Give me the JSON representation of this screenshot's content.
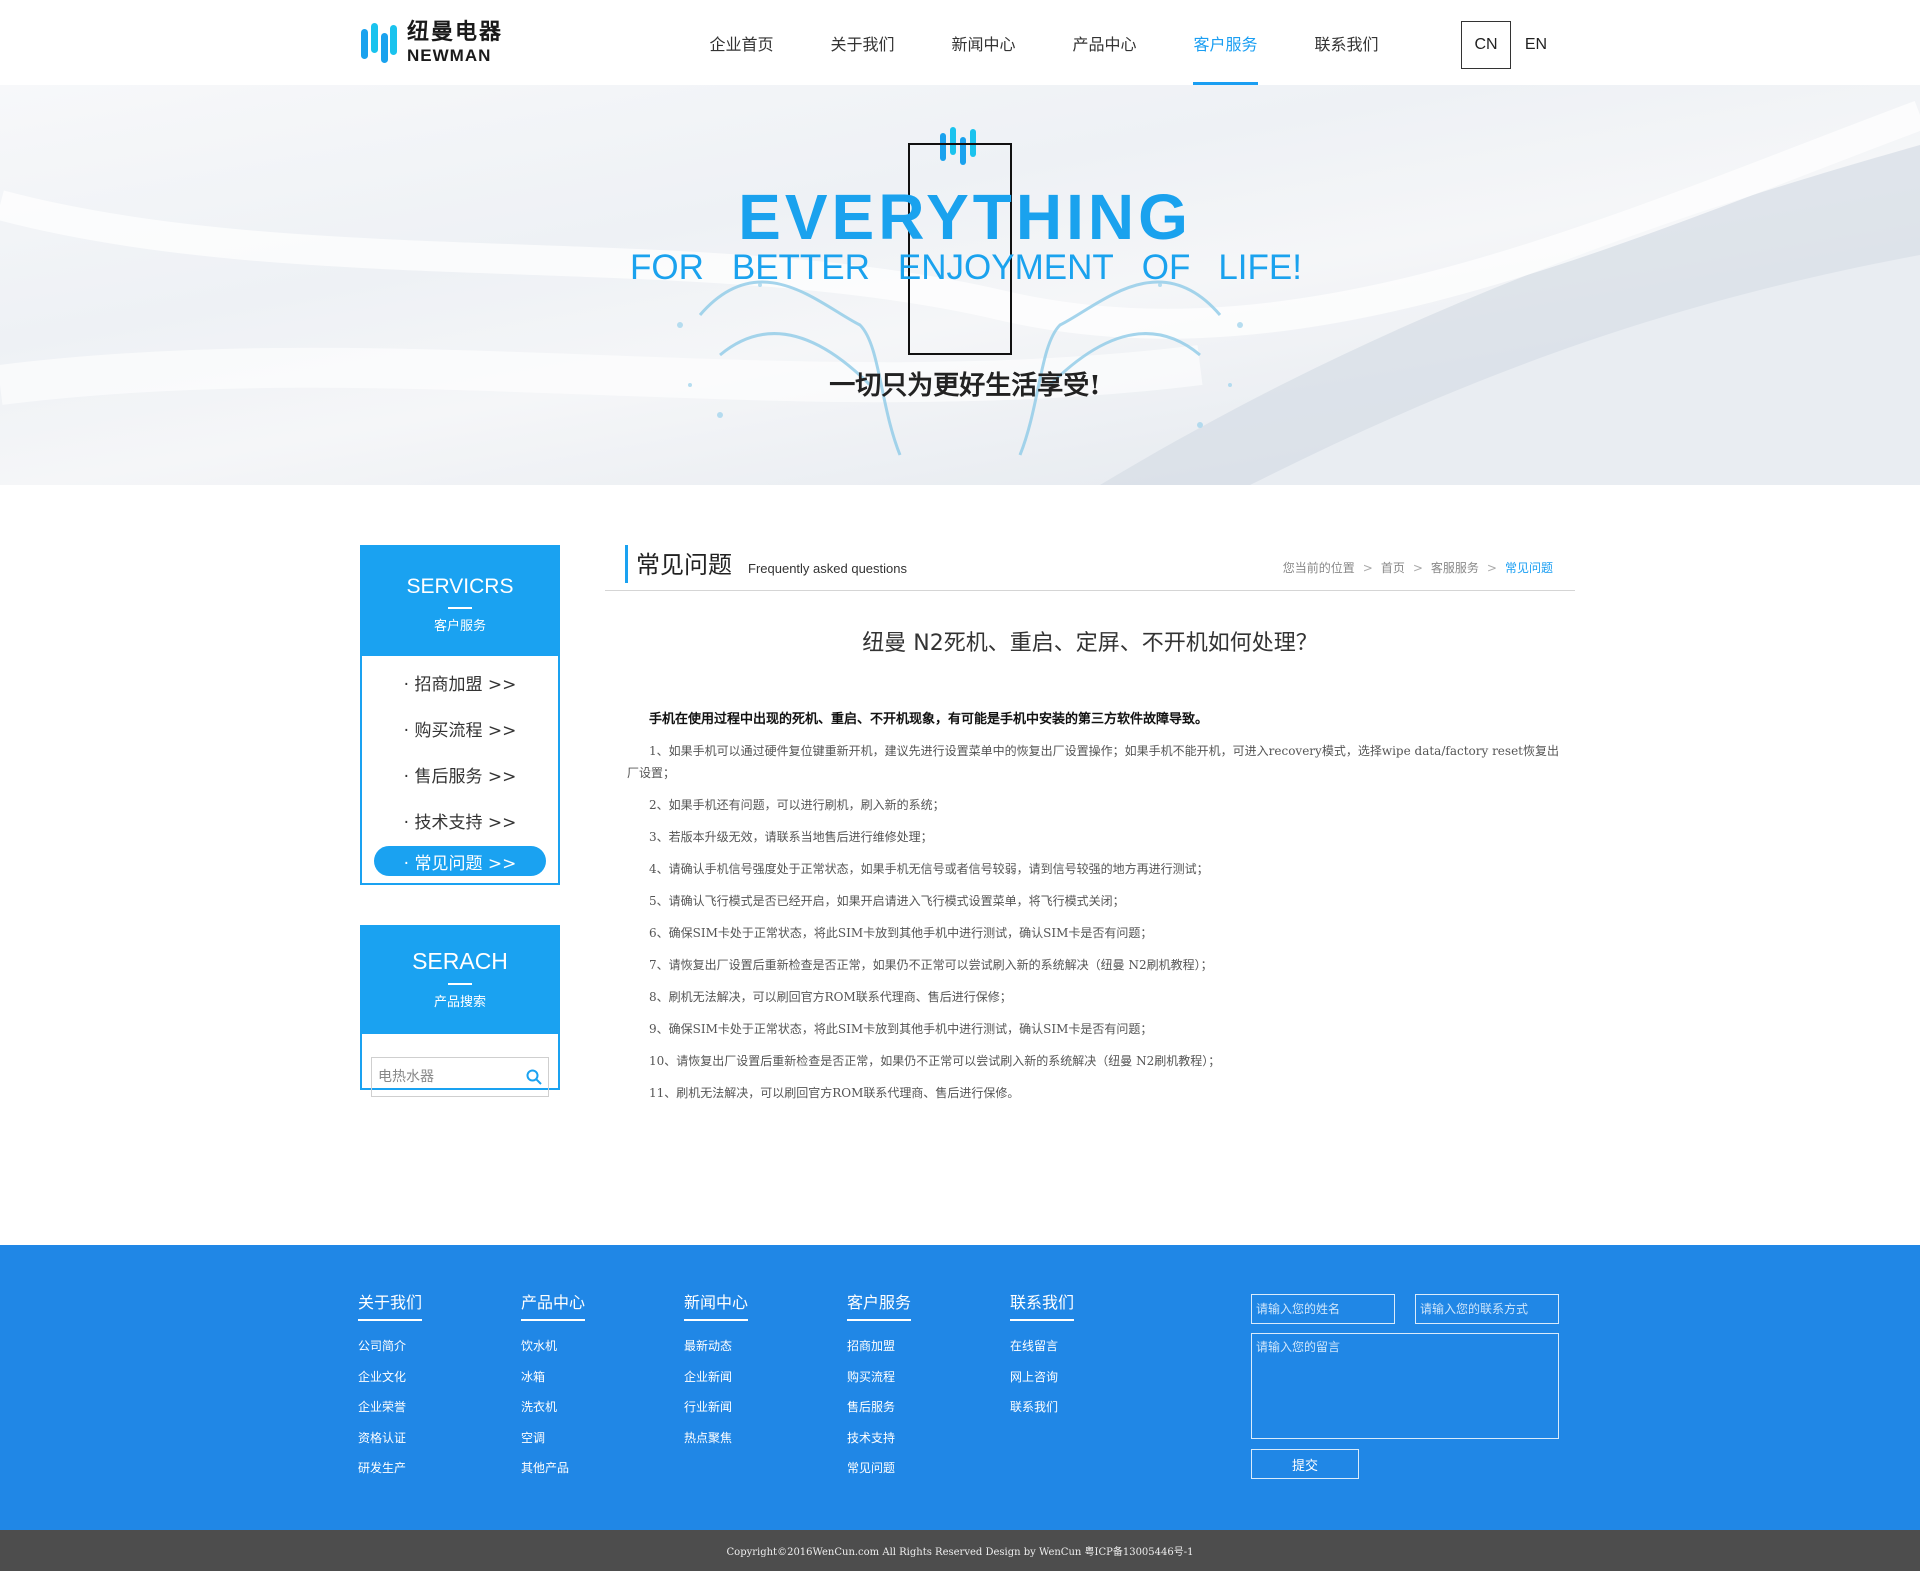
{
  "header": {
    "logo_cn": "纽曼电器",
    "logo_en": "NEWMAN",
    "nav": [
      "企业首页",
      "关于我们",
      "新闻中心",
      "产品中心",
      "客户服务",
      "联系我们"
    ],
    "nav_active": "客户服务",
    "lang_cn": "CN",
    "lang_en": "EN",
    "accent": "#1a9ef2"
  },
  "banner": {
    "headline": "EVERYTHING",
    "tagline_words": [
      "FOR",
      "BETTER",
      "ENJOYMENT",
      "OF",
      "LIFE!"
    ],
    "slogan_cn": "一切只为更好生活享受!"
  },
  "sidebar": {
    "services_title": "SERVICRS",
    "services_sub": "客户服务",
    "items": [
      "· 招商加盟 >>",
      "· 购买流程 >>",
      "· 售后服务 >>",
      "· 技术支持 >>",
      "· 常见问题 >>"
    ],
    "active_item": "· 常见问题 >>",
    "search_title": "SERACH",
    "search_sub": "产品搜索",
    "search_placeholder": "电热水器",
    "search_icon": "search-icon"
  },
  "main": {
    "section_title": "常见问题",
    "section_en": "Frequently asked questions",
    "breadcrumb": {
      "prefix": "您当前的位置",
      "home": "首页",
      "parent": "客服服务",
      "current": "常见问题"
    },
    "article_title": "纽曼 N2死机、重启、定屏、不开机如何处理？",
    "lead": "手机在使用过程中出现的死机、重启、不开机现象，有可能是手机中安装的第三方软件故障导致。",
    "paragraphs": [
      "1、如果手机可以通过硬件复位键重新开机，建议先进行设置菜单中的恢复出厂设置操作；如果手机不能开机，可进入recovery模式，选择wipe data/factory reset恢复出厂设置；",
      "2、如果手机还有问题，可以进行刷机，刷入新的系统；",
      "3、若版本升级无效，请联系当地售后进行维修处理；",
      "4、请确认手机信号强度处于正常状态，如果手机无信号或者信号较弱，请到信号较强的地方再进行测试；",
      "5、请确认飞行模式是否已经开启，如果开启请进入飞行模式设置菜单，将飞行模式关闭；",
      "6、确保SIM卡处于正常状态，将此SIM卡放到其他手机中进行测试，确认SIM卡是否有问题；",
      "7、请恢复出厂设置后重新检查是否正常，如果仍不正常可以尝试刷入新的系统解决（纽曼 N2刷机教程）；",
      "8、刷机无法解决，可以刷回官方ROM联系代理商、售后进行保修；",
      "9、确保SIM卡处于正常状态，将此SIM卡放到其他手机中进行测试，确认SIM卡是否有问题；",
      "10、请恢复出厂设置后重新检查是否正常，如果仍不正常可以尝试刷入新的系统解决（纽曼 N2刷机教程）；",
      "11、刷机无法解决，可以刷回官方ROM联系代理商、售后进行保修。"
    ]
  },
  "footer": {
    "columns": [
      {
        "title": "关于我们",
        "links": [
          "公司简介",
          "企业文化",
          "企业荣誉",
          "资格认证",
          "研发生产"
        ]
      },
      {
        "title": "产品中心",
        "links": [
          "饮水机",
          "冰箱",
          "洗衣机",
          "空调",
          "其他产品"
        ]
      },
      {
        "title": "新闻中心",
        "links": [
          "最新动态",
          "企业新闻",
          "行业新闻",
          "热点聚焦"
        ]
      },
      {
        "title": "客户服务",
        "links": [
          "招商加盟",
          "购买流程",
          "售后服务",
          "技术支持",
          "常见问题"
        ]
      },
      {
        "title": "联系我们",
        "links": [
          "在线留言",
          "网上咨询",
          "联系我们"
        ]
      }
    ],
    "name_placeholder": "请输入您的姓名",
    "contact_placeholder": "请输入您的联系方式",
    "message_placeholder": "请输入您的留言",
    "submit_label": "提交",
    "background": "#2087e6",
    "copyright": "Copyright©2016WenCun.com All Rights Reserved Design by WenCun 粤ICP备13005446号-1"
  }
}
